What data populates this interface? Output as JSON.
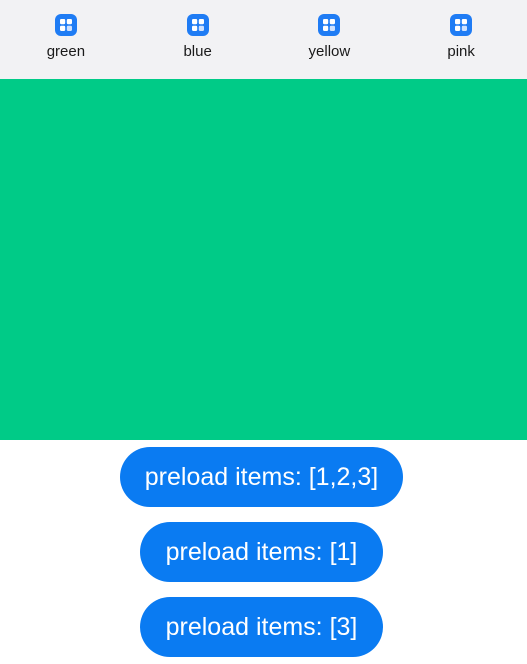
{
  "tabs": [
    {
      "label": "green",
      "icon": "grid-icon"
    },
    {
      "label": "blue",
      "icon": "grid-icon"
    },
    {
      "label": "yellow",
      "icon": "grid-icon"
    },
    {
      "label": "pink",
      "icon": "grid-icon"
    }
  ],
  "colors": {
    "tabbar_bg": "#f2f2f4",
    "icon": "#1f7cf4",
    "panel_green": "#00cb87",
    "button": "#0a7bf2",
    "button_text": "#ffffff"
  },
  "buttons": [
    {
      "label": "preload items: [1,2,3]"
    },
    {
      "label": "preload items: [1]"
    },
    {
      "label": "preload items: [3]"
    }
  ]
}
